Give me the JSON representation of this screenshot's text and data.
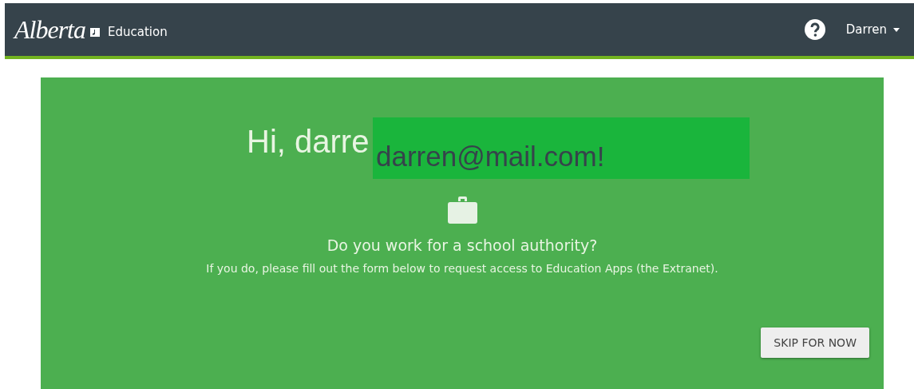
{
  "header": {
    "logo": "Alberta",
    "product": "Education",
    "user": "Darren"
  },
  "banner": {
    "greeting": "Hi, darre",
    "overlay_text": "darren@mail.com!",
    "question": "Do you work for a school authority?",
    "message": "If you do, please fill out the form below to request access to Education Apps (the Extranet).",
    "button": "SKIP FOR NOW"
  }
}
